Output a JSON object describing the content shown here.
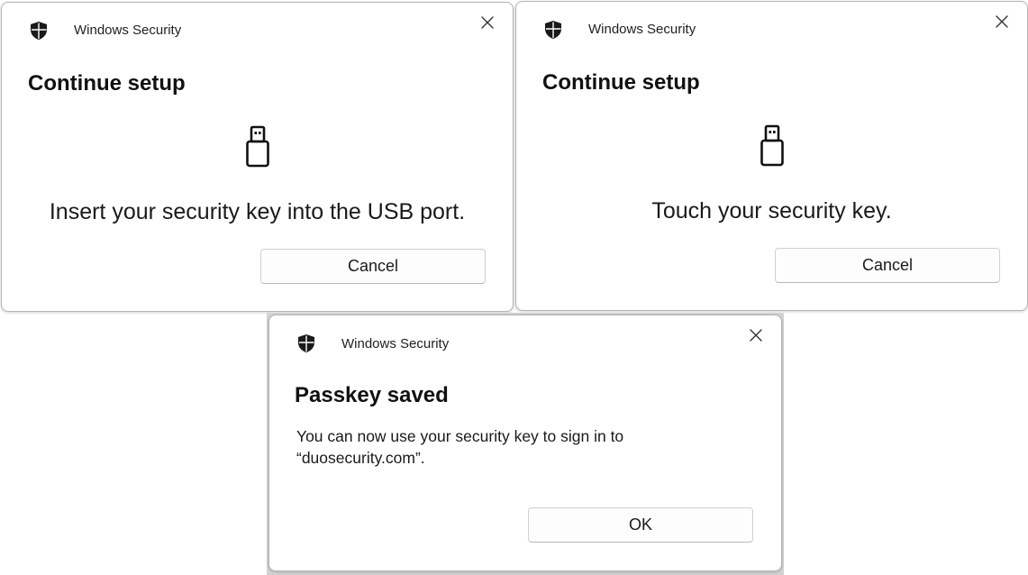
{
  "dialogs": [
    {
      "window_title": "Windows Security",
      "heading": "Continue setup",
      "instruction": "Insert your security key into the USB port.",
      "button_label": "Cancel"
    },
    {
      "window_title": "Windows Security",
      "heading": "Continue setup",
      "instruction": "Touch your security key.",
      "button_label": "Cancel"
    },
    {
      "window_title": "Windows Security",
      "heading": "Passkey saved",
      "body_line1": "You can now use your security key to sign in to",
      "body_line2": "“duosecurity.com”.",
      "button_label": "OK"
    }
  ],
  "icons": {
    "titlebar": "shield-icon",
    "close": "close-icon",
    "security_key": "usb-security-key-icon"
  }
}
